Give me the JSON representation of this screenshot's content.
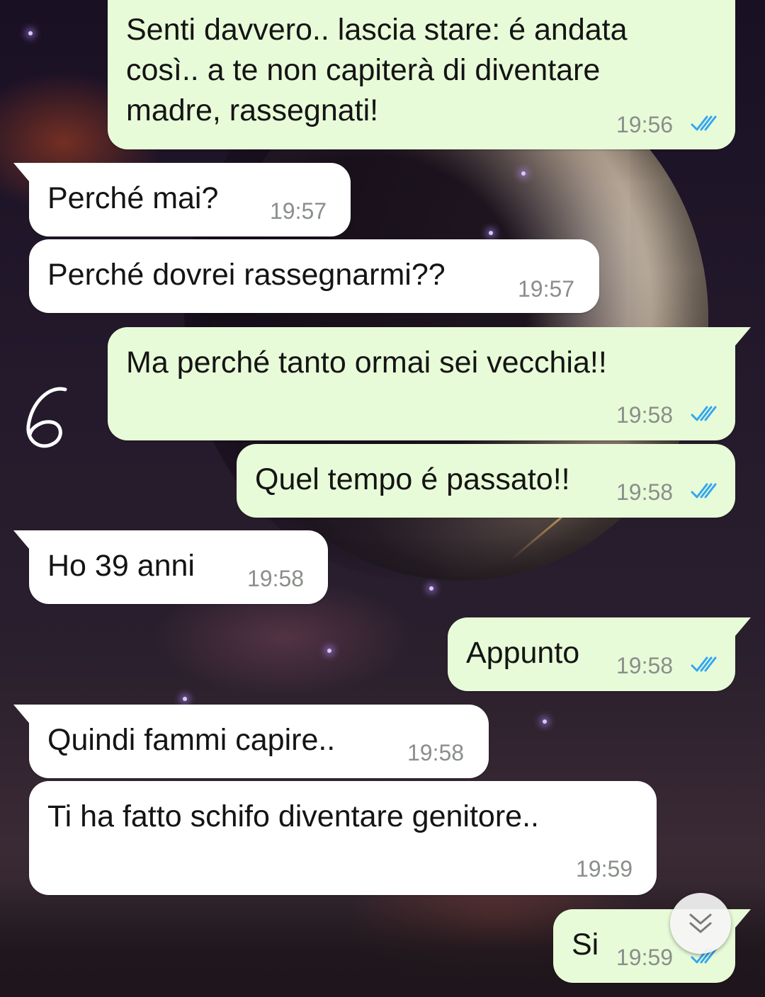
{
  "conversation": {
    "messages": [
      {
        "direction": "out",
        "text": "Senti davvero.. lascia stare: é andata\ncosì.. a te non capiterà di diventare\nmadre, rassegnati!",
        "time": "19:56",
        "status": "read"
      },
      {
        "direction": "in",
        "text": "Perché mai?",
        "time": "19:57"
      },
      {
        "direction": "in",
        "text": "Perché dovrei rassegnarmi??",
        "time": "19:57"
      },
      {
        "direction": "out",
        "text": "Ma perché tanto ormai sei vecchia!!",
        "time": "19:58",
        "status": "read"
      },
      {
        "direction": "out",
        "text": "Quel tempo é passato!!",
        "time": "19:58",
        "status": "read"
      },
      {
        "direction": "in",
        "text": "Ho 39 anni",
        "time": "19:58"
      },
      {
        "direction": "out",
        "text": "Appunto",
        "time": "19:58",
        "status": "read"
      },
      {
        "direction": "in",
        "text": "Quindi fammi capire..",
        "time": "19:58"
      },
      {
        "direction": "in",
        "text": "Ti ha fatto schifo diventare genitore..",
        "time": "19:59"
      },
      {
        "direction": "out",
        "text": "Si",
        "time": "19:59",
        "status": "read"
      }
    ]
  },
  "overlay": {
    "handwritten_number": "6"
  },
  "icons": {
    "read_ticks": "double-check-icon",
    "scroll_down": "chevron-double-down-icon"
  },
  "colors": {
    "incoming_bubble": "#ffffff",
    "outgoing_bubble": "#e8fbd8",
    "timestamp": "#8a8f8a",
    "read_ticks": "#34a6f0"
  }
}
